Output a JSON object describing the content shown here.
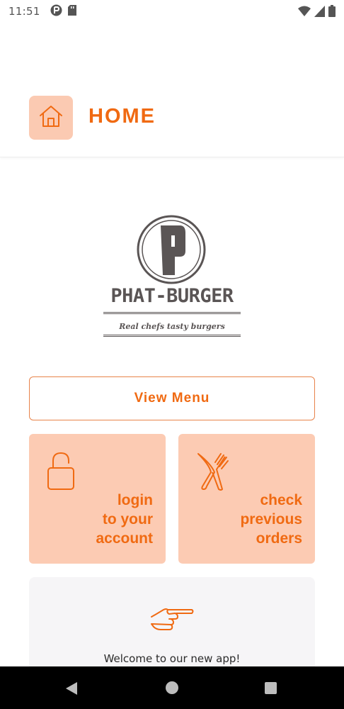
{
  "status_bar": {
    "time": "11:51",
    "left_icons": [
      "sync-icon",
      "sd-card-icon"
    ],
    "right_icons": [
      "wifi-icon",
      "cellular-signal-icon",
      "battery-icon"
    ]
  },
  "header": {
    "icon": "home-icon",
    "title": "HOME"
  },
  "logo": {
    "letter": "P",
    "brand": "PHAT-BURGER",
    "tagline": "Real chefs tasty burgers"
  },
  "view_menu": {
    "label": "View Menu"
  },
  "tiles": [
    {
      "icon": "padlock-icon",
      "label": "login\nto your\naccount"
    },
    {
      "icon": "fork-knife-icon",
      "label": "check\nprevious\norders"
    }
  ],
  "welcome": {
    "icon": "pointing-hand-icon",
    "text": "Welcome to our new app!"
  },
  "colors": {
    "accent": "#f06a12",
    "tile_bg": "#fccbb3",
    "logo_gray": "#5a5555",
    "card_bg": "#f6f5f7"
  },
  "nav_bar": {
    "icons": [
      "back-icon",
      "home-circle-icon",
      "recents-icon"
    ]
  }
}
